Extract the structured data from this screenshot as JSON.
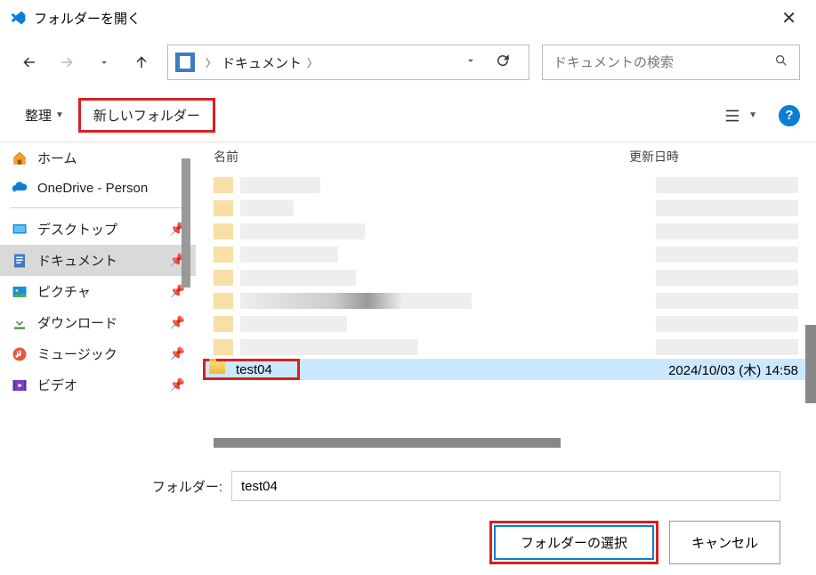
{
  "title": "フォルダーを開く",
  "breadcrumb": {
    "current": "ドキュメント"
  },
  "search": {
    "placeholder": "ドキュメントの検索"
  },
  "toolbar": {
    "organize": "整理",
    "new_folder": "新しいフォルダー"
  },
  "sidebar": {
    "home": "ホーム",
    "onedrive": "OneDrive - Person",
    "desktop": "デスクトップ",
    "documents": "ドキュメント",
    "pictures": "ピクチャ",
    "downloads": "ダウンロード",
    "music": "ミュージック",
    "videos": "ビデオ"
  },
  "columns": {
    "name": "名前",
    "date": "更新日時"
  },
  "selected_folder": {
    "name": "test04",
    "date": "2024/10/03 (木) 14:58"
  },
  "footer": {
    "folder_label": "フォルダー:",
    "folder_value": "test04",
    "select_button": "フォルダーの選択",
    "cancel_button": "キャンセル"
  }
}
